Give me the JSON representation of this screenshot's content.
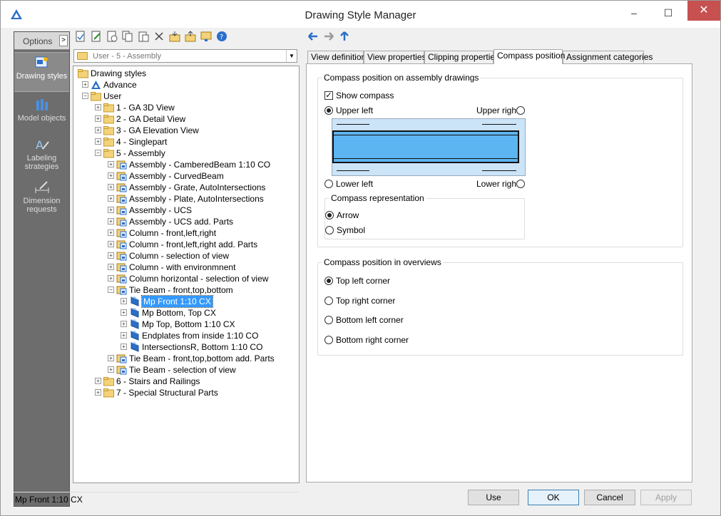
{
  "window": {
    "title": "Drawing Style Manager",
    "minimize": "–",
    "maximize": "☐",
    "close": "✕"
  },
  "sidebar": {
    "options_label": "Options",
    "options_arrow": ">",
    "items": [
      {
        "label": "Drawing styles",
        "active": true
      },
      {
        "label": "Model objects"
      },
      {
        "label": "Labeling strategies"
      },
      {
        "label": "Dimension requests"
      }
    ]
  },
  "combo": {
    "value": "User - 5 - Assembly",
    "arrow": "▼"
  },
  "tree": {
    "root": "Drawing styles",
    "advance": "Advance",
    "user": "User",
    "categories": [
      "1 - GA 3D View",
      "2 - GA Detail View",
      "3 - GA Elevation View",
      "4 - Singlepart",
      "5 - Assembly"
    ],
    "assembly_items": [
      "Assembly - CamberedBeam 1:10 CO",
      "Assembly - CurvedBeam",
      "Assembly - Grate, AutoIntersections",
      "Assembly - Plate, AutoIntersections",
      "Assembly - UCS",
      "Assembly - UCS add. Parts",
      "Column - front,left,right",
      "Column - front,left,right add. Parts",
      "Column - selection of view",
      "Column - with environmnent",
      "Column horizontal - selection of view",
      "Tie Beam - front,top,bottom"
    ],
    "tie_beam_children": [
      "Mp Front 1:10 CX",
      "Mp Bottom, Top CX",
      "Mp Top, Bottom 1:10 CX",
      "Endplates from inside 1:10 CO",
      "IntersectionsR, Bottom 1:10 CO"
    ],
    "after_tie": [
      "Tie Beam - front,top,bottom add. Parts",
      "Tie Beam - selection of view"
    ],
    "final_categories": [
      "6 - Stairs and Railings",
      "7 - Special Structural Parts"
    ],
    "expander_plus": "+",
    "expander_minus": "−"
  },
  "status": {
    "text": "Mp Front 1:10 CX"
  },
  "tabs": [
    {
      "label": "View definition"
    },
    {
      "label": "View properties"
    },
    {
      "label": "Clipping properties"
    },
    {
      "label": "Compass position",
      "active": true
    },
    {
      "label": "Assignment categories"
    }
  ],
  "compass": {
    "assembly_group": "Compass position on assembly drawings",
    "show_compass": "Show compass",
    "show_compass_checked": true,
    "check_mark": "✓",
    "upper_left": "Upper left",
    "upper_right": "Upper right",
    "lower_left": "Lower left",
    "lower_right": "Lower right",
    "selected_position": "Upper left",
    "representation_group": "Compass representation",
    "arrow": "Arrow",
    "symbol": "Symbol",
    "selected_representation": "Arrow",
    "overviews_group": "Compass position in overviews",
    "top_left": "Top left corner",
    "top_right": "Top right corner",
    "bottom_left": "Bottom left corner",
    "bottom_right": "Bottom right corner",
    "selected_overview": "Top left corner"
  },
  "buttons": {
    "use": "Use",
    "ok": "OK",
    "cancel": "Cancel",
    "apply": "Apply"
  },
  "colors": {
    "accent": "#3399ff",
    "close_red": "#c75050",
    "sidebar": "#6d6d6d",
    "beam": "#5cb4f0"
  }
}
